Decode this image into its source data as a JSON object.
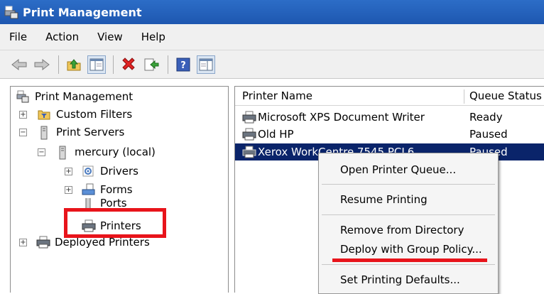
{
  "window": {
    "title": "Print Management"
  },
  "menu": [
    "File",
    "Action",
    "View",
    "Help"
  ],
  "toolbar": {
    "icons": [
      "back-arrow-icon",
      "forward-arrow-icon",
      "up-folder-icon",
      "show-hide-tree-icon",
      "delete-icon",
      "export-list-icon",
      "help-icon",
      "action-pane-icon"
    ]
  },
  "tree": {
    "root": "Print Management",
    "custom_filters": "Custom Filters",
    "print_servers": "Print Servers",
    "server": "mercury (local)",
    "drivers": "Drivers",
    "forms": "Forms",
    "ports": "Ports",
    "printers": "Printers",
    "deployed_printers": "Deployed Printers"
  },
  "list": {
    "columns": [
      "Printer Name",
      "Queue Status"
    ],
    "rows": [
      {
        "name": "Microsoft XPS Document Writer",
        "status": "Ready"
      },
      {
        "name": "Old HP",
        "status": "Paused"
      },
      {
        "name": "Xerox WorkCentre 7545 PCL6",
        "status": "Paused"
      }
    ]
  },
  "context_menu": {
    "items": [
      "Open Printer Queue...",
      "Resume Printing",
      "Remove from Directory",
      "Deploy with Group Policy...",
      "Set Printing Defaults..."
    ]
  },
  "colors": {
    "title_bar": "#1e57b0",
    "selection": "#0a246a",
    "highlight_annotation": "#e8141b"
  }
}
